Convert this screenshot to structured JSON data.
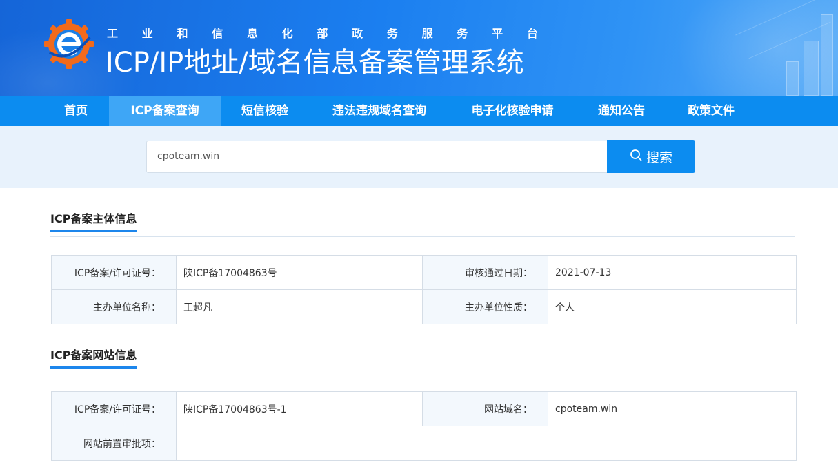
{
  "header": {
    "subtitle_chars": [
      "工",
      "业",
      "和",
      "信",
      "息",
      "化",
      "部",
      "政",
      "务",
      "服",
      "务",
      "平",
      "台"
    ],
    "title": "ICP/IP地址/域名信息备案管理系统",
    "logo_icon": "gear-e-logo-icon",
    "colors": {
      "banner": "#1b7ff0",
      "nav": "#0c8cf0",
      "nav_active": "#3ea6f6",
      "accent": "#1d86ec"
    }
  },
  "nav": {
    "items": [
      {
        "label": "首页"
      },
      {
        "label": "ICP备案查询"
      },
      {
        "label": "短信核验"
      },
      {
        "label": "违法违规域名查询"
      },
      {
        "label": "电子化核验申请"
      },
      {
        "label": "通知公告"
      },
      {
        "label": "政策文件"
      }
    ],
    "active": "ICP备案查询"
  },
  "search": {
    "value": "cpoteam.win",
    "button_label": "搜索",
    "button_icon": "search-icon"
  },
  "subject_info": {
    "title": "ICP备案主体信息",
    "rows": [
      {
        "label1": "ICP备案/许可证号：",
        "value1": "陕ICP备17004863号",
        "label2": "审核通过日期：",
        "value2": "2021-07-13"
      },
      {
        "label1": "主办单位名称：",
        "value1": "王超凡",
        "label2": "主办单位性质：",
        "value2": "个人"
      }
    ]
  },
  "website_info": {
    "title": "ICP备案网站信息",
    "rows": [
      {
        "label1": "ICP备案/许可证号：",
        "value1": "陕ICP备17004863号-1",
        "label2": "网站域名：",
        "value2": "cpoteam.win"
      },
      {
        "label1": "网站前置审批项：",
        "value1": ""
      }
    ]
  }
}
